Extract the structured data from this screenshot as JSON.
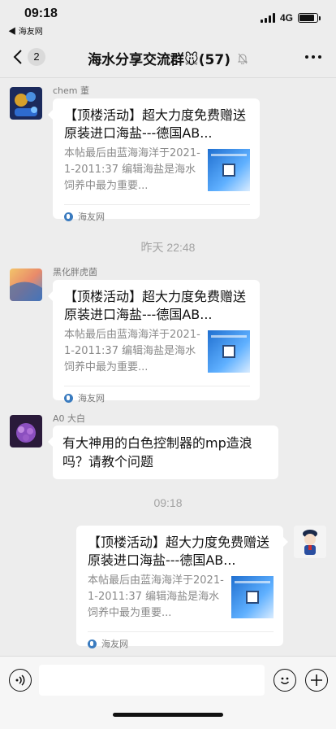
{
  "status": {
    "time": "09:18",
    "back_app": "◀ 海友网",
    "network": "4G",
    "battery_level": 0.85
  },
  "nav": {
    "unread_count": "2",
    "title": "海水分享交流群🐭(57)"
  },
  "share_card": {
    "title": "【顶楼活动】超大力度免费赠送原装进口海盐---德国AB...",
    "description": "本帖最后由蓝海海洋于2021-1-2011:37 编辑海盐是海水饲养中最为重要...",
    "source": "海友网"
  },
  "messages": [
    {
      "sender": "chem 董"
    },
    {
      "sender": "黑化胖虎菌"
    },
    {
      "sender": "A0 大白",
      "text": "有大神用的白色控制器的mp造浪吗？请教个问题"
    }
  ],
  "timestamps": [
    "昨天 22:48",
    "09:18"
  ],
  "input": {
    "placeholder": ""
  },
  "icons": {
    "back": "chevron-left-icon",
    "mute": "bell-off-icon",
    "more": "more-dots-icon",
    "voice": "voice-icon",
    "emoji": "emoji-icon",
    "plus": "plus-icon"
  }
}
